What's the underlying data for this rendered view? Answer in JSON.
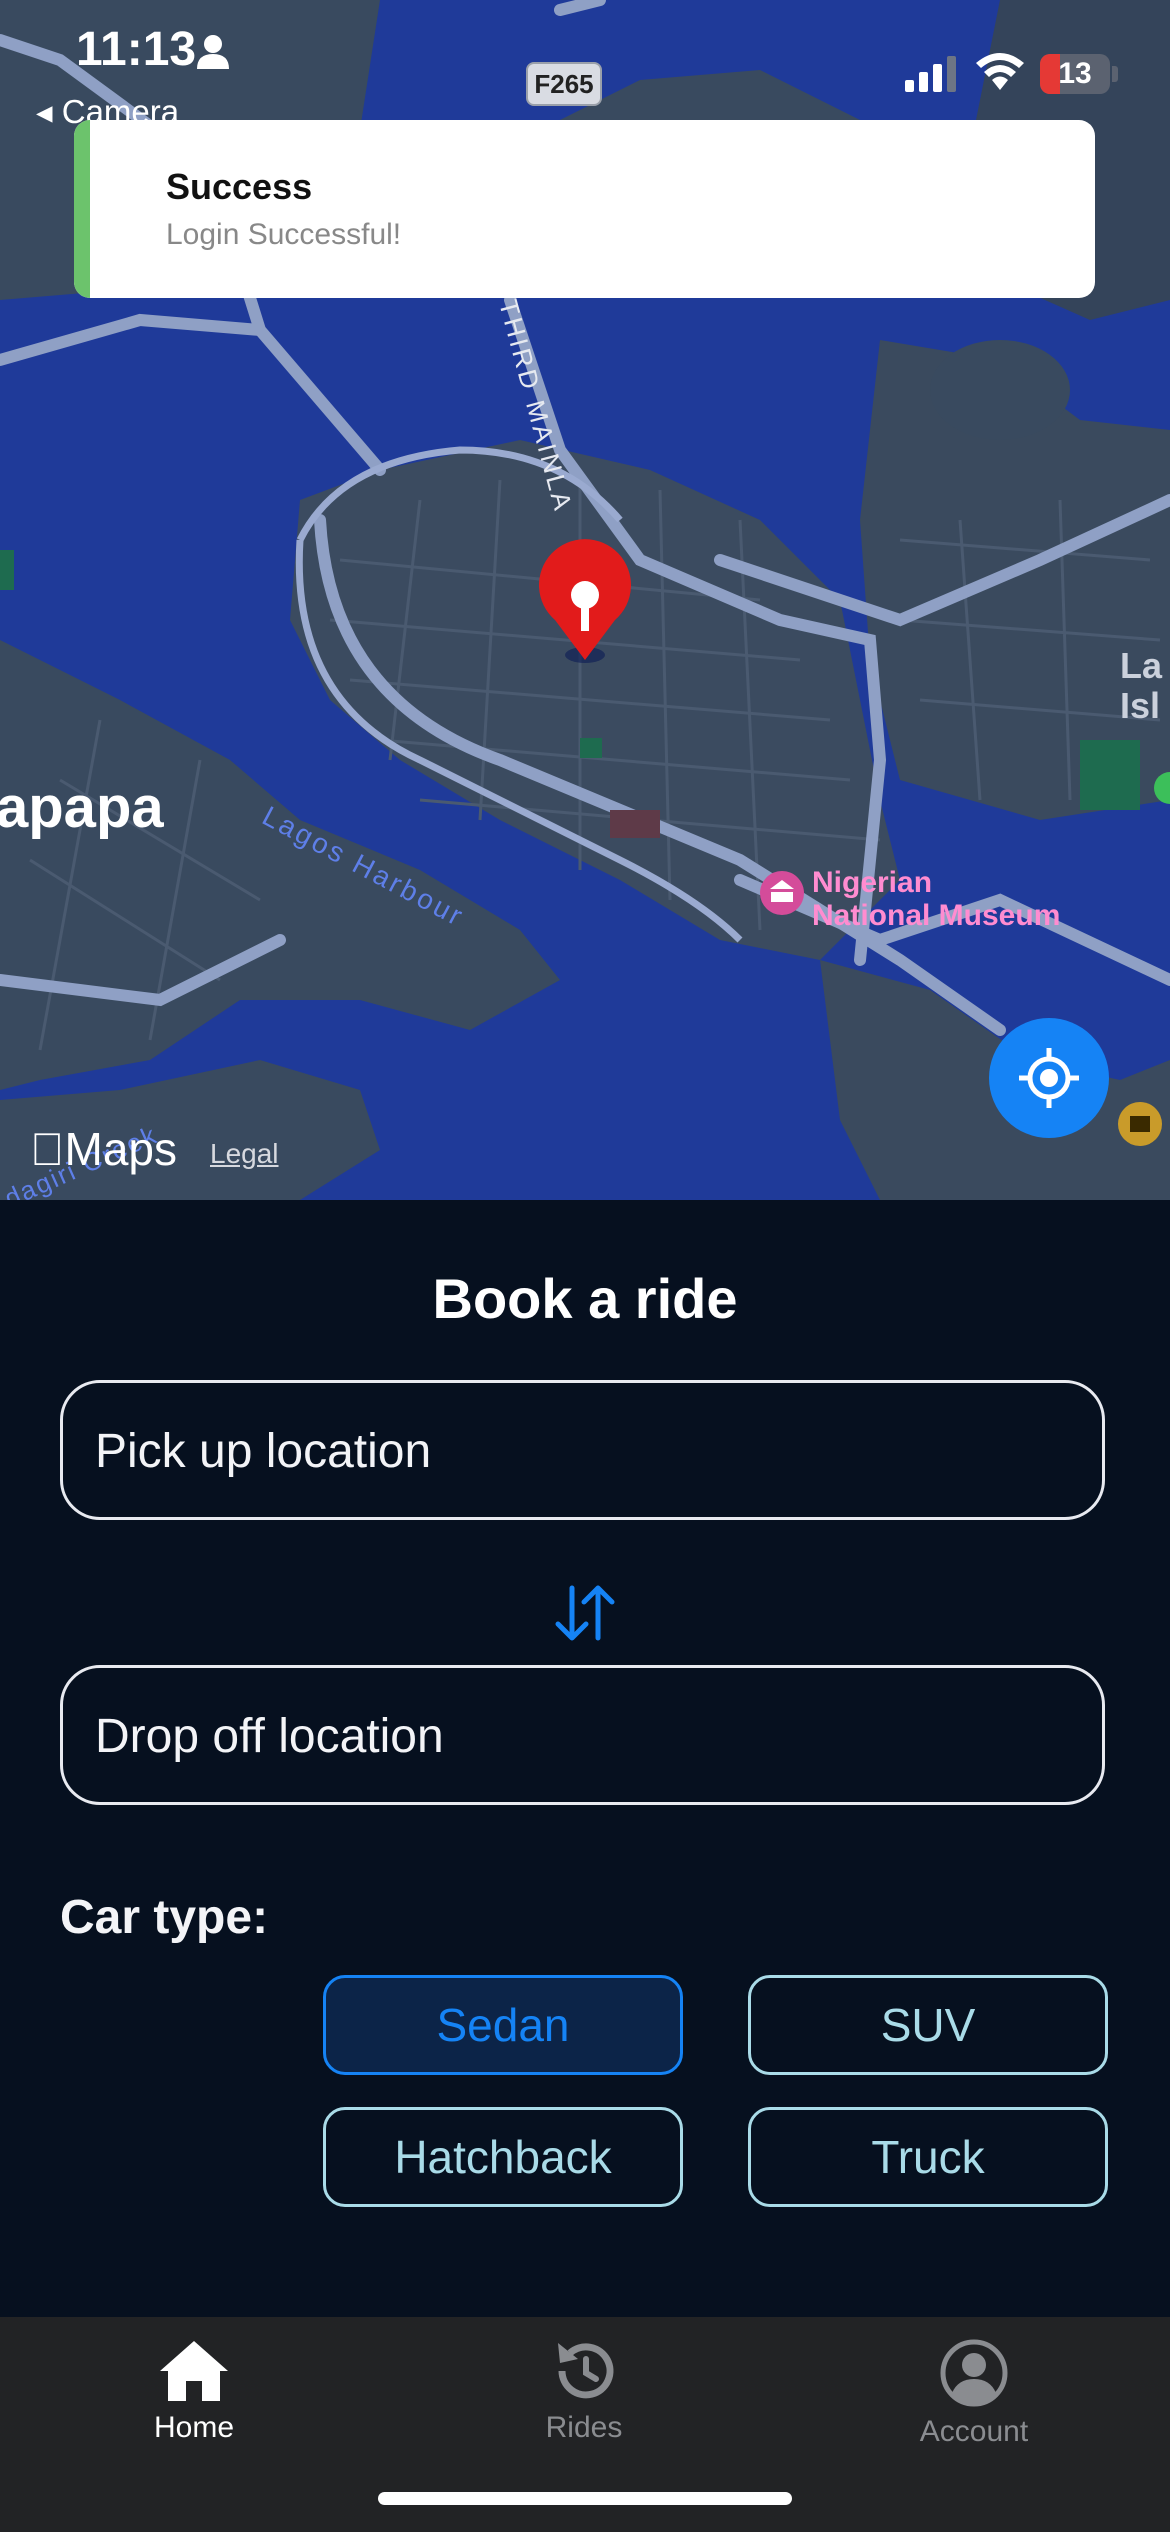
{
  "status_bar": {
    "time": "11:13",
    "back_label": "◂ Camera",
    "map_badge": "F265",
    "battery": "13",
    "battery_level": 0.13
  },
  "toast": {
    "title": "Success",
    "message": "Login Successful!",
    "accent_color": "#6cc36c"
  },
  "map": {
    "labels": {
      "apapa": "apapa",
      "lagos_island": [
        "La",
        "Isl"
      ],
      "museum": [
        "Nigerian",
        "National Museum"
      ],
      "harbour": "Lagos Harbour",
      "road": "THIRD MAINLA",
      "creek": "dagiri Creek"
    },
    "attribution": "Maps",
    "legal": "Legal",
    "pin_icon": "map-pin-icon",
    "locate_icon": "locate-icon"
  },
  "booking": {
    "title": "Book a ride",
    "pickup_placeholder": "Pick up location",
    "pickup_value": "",
    "dropoff_placeholder": "Drop off location",
    "dropoff_value": "",
    "car_type_label": "Car type:",
    "car_types": [
      "Sedan",
      "SUV",
      "Hatchback",
      "Truck"
    ],
    "selected_car_type": "Sedan",
    "accent_color": "#1583f5"
  },
  "tabs": [
    {
      "label": "Home",
      "icon": "home-icon",
      "active": true
    },
    {
      "label": "Rides",
      "icon": "history-icon",
      "active": false
    },
    {
      "label": "Account",
      "icon": "account-icon",
      "active": false
    }
  ]
}
